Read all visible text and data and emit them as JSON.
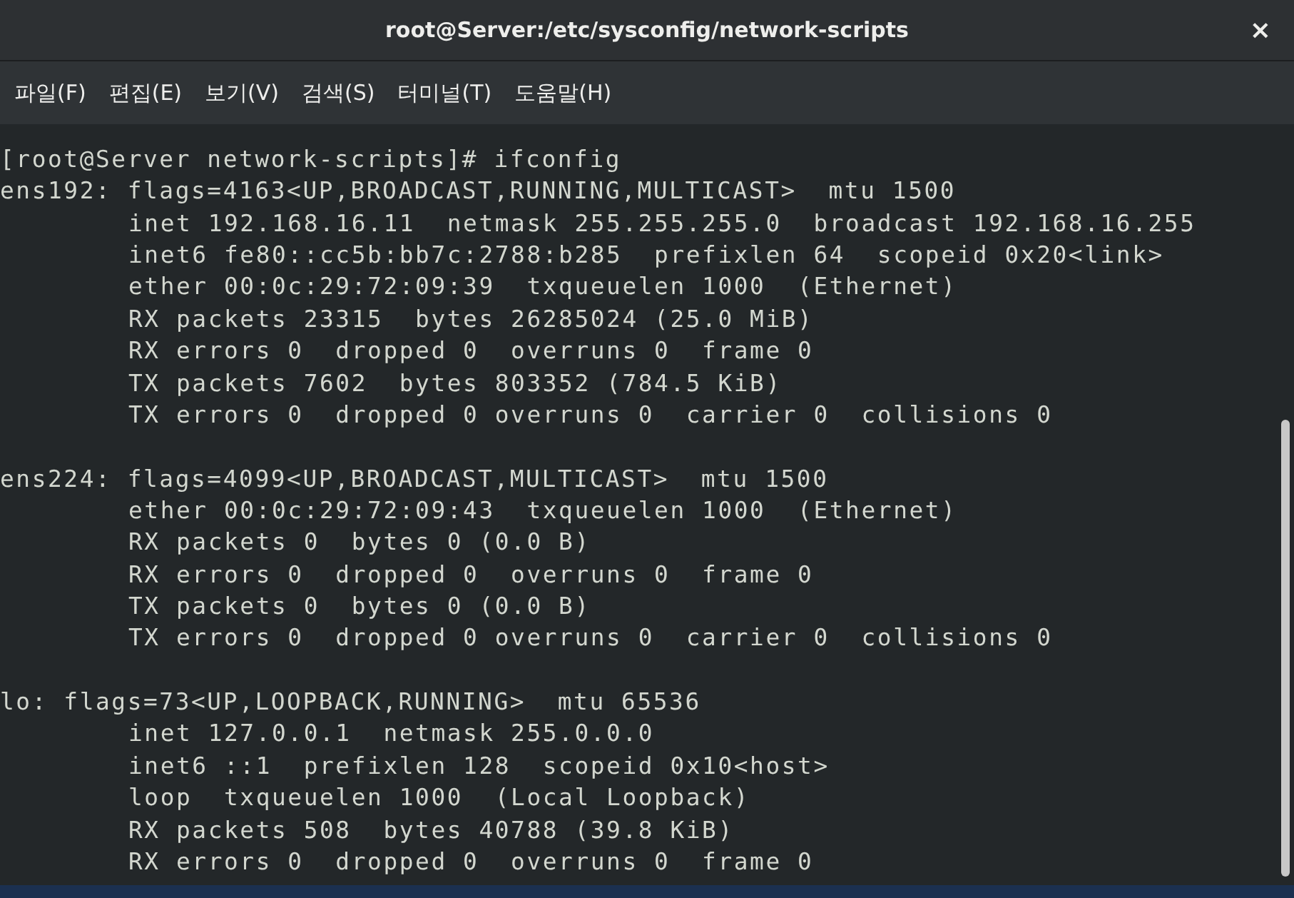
{
  "window": {
    "title": "root@Server:/etc/sysconfig/network-scripts",
    "close": "×"
  },
  "menu": [
    {
      "label": "파일(F)"
    },
    {
      "label": "편집(E)"
    },
    {
      "label": "보기(V)"
    },
    {
      "label": "검색(S)"
    },
    {
      "label": "터미널(T)"
    },
    {
      "label": "도움말(H)"
    }
  ],
  "terminal": {
    "prompt": "[root@Server network-scripts]# ifconfig",
    "blocks": [
      {
        "header": "ens192: flags=4163<UP,BROADCAST,RUNNING,MULTICAST>  mtu 1500",
        "lines": [
          "inet 192.168.16.11  netmask 255.255.255.0  broadcast 192.168.16.255",
          "inet6 fe80::cc5b:bb7c:2788:b285  prefixlen 64  scopeid 0x20<link>",
          "ether 00:0c:29:72:09:39  txqueuelen 1000  (Ethernet)",
          "RX packets 23315  bytes 26285024 (25.0 MiB)",
          "RX errors 0  dropped 0  overruns 0  frame 0",
          "TX packets 7602  bytes 803352 (784.5 KiB)",
          "TX errors 0  dropped 0 overruns 0  carrier 0  collisions 0"
        ]
      },
      {
        "header": "ens224: flags=4099<UP,BROADCAST,MULTICAST>  mtu 1500",
        "lines": [
          "ether 00:0c:29:72:09:43  txqueuelen 1000  (Ethernet)",
          "RX packets 0  bytes 0 (0.0 B)",
          "RX errors 0  dropped 0  overruns 0  frame 0",
          "TX packets 0  bytes 0 (0.0 B)",
          "TX errors 0  dropped 0 overruns 0  carrier 0  collisions 0"
        ]
      },
      {
        "header": "lo: flags=73<UP,LOOPBACK,RUNNING>  mtu 65536",
        "lines": [
          "inet 127.0.0.1  netmask 255.0.0.0",
          "inet6 ::1  prefixlen 128  scopeid 0x10<host>",
          "loop  txqueuelen 1000  (Local Loopback)",
          "RX packets 508  bytes 40788 (39.8 KiB)",
          "RX errors 0  dropped 0  overruns 0  frame 0"
        ]
      }
    ]
  }
}
